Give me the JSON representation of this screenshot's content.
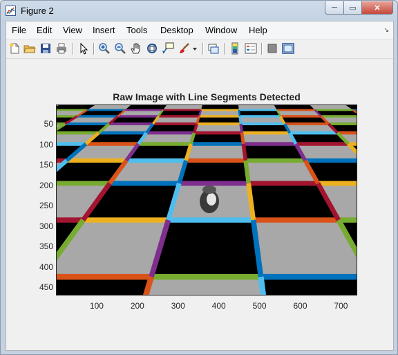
{
  "window": {
    "title": "Figure 2"
  },
  "window_buttons": {
    "min": "─",
    "max": "▭",
    "close": "✕"
  },
  "menu": {
    "items": [
      "File",
      "Edit",
      "View",
      "Insert",
      "Tools",
      "Desktop",
      "Window",
      "Help"
    ],
    "overflow_icon": "↘"
  },
  "toolbar": {
    "icons": [
      "new-figure-icon",
      "open-file-icon",
      "save-icon",
      "print-icon",
      "edit-plot-arrow-icon",
      "zoom-in-icon",
      "zoom-out-icon",
      "pan-hand-icon",
      "rotate-3d-icon",
      "data-cursor-icon",
      "brush-icon",
      "brush-dropdown-icon",
      "link-plot-icon",
      "colorbar-icon",
      "legend-icon",
      "hide-plot-tools-icon",
      "show-plot-tools-icon"
    ]
  },
  "plot": {
    "title": "Raw Image with Line Segments Detected",
    "xticks": [
      "100",
      "200",
      "300",
      "400",
      "500",
      "600",
      "700"
    ],
    "yticks": [
      "50",
      "100",
      "150",
      "200",
      "250",
      "300",
      "350",
      "400",
      "450"
    ]
  },
  "colors": {
    "line_palette": [
      "#0072bd",
      "#d95319",
      "#edb120",
      "#7e2f8e",
      "#77ac30",
      "#4dbeee",
      "#a2142f"
    ],
    "tile_light": "#a8a8a8",
    "tile_dark": "#000000"
  }
}
